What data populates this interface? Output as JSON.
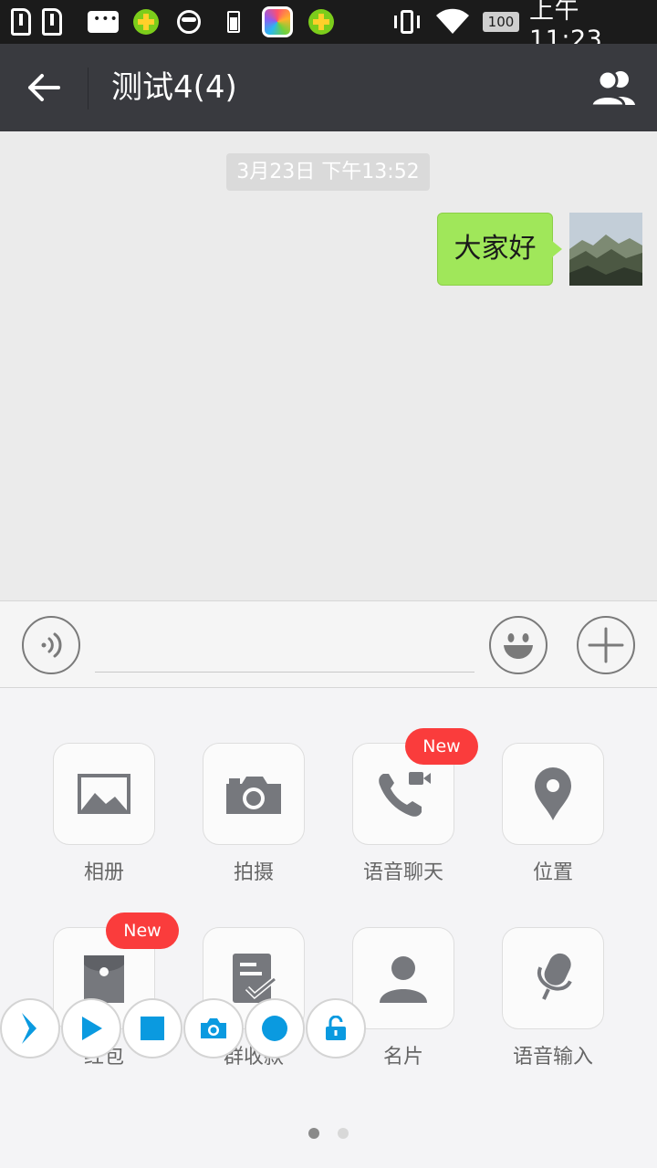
{
  "status_bar": {
    "battery_label": "100",
    "time": "上午11:23",
    "icons": [
      "sim1-icon",
      "sim2-icon",
      "message-icon",
      "360-plus-icon",
      "face-icon",
      "battery-small-icon",
      "colorful-app-icon",
      "360-plus-icon",
      "vibrate-icon",
      "wifi-icon",
      "battery-icon"
    ]
  },
  "titlebar": {
    "title": "测试4(4)",
    "back_icon": "arrow-left-icon",
    "group_icon": "group-members-icon"
  },
  "chat": {
    "timestamp": "3月23日 下午13:52",
    "messages": [
      {
        "text": "大家好",
        "sender": "self",
        "bubble_color": "#a0e75a"
      }
    ]
  },
  "input_bar": {
    "value": "",
    "placeholder": "",
    "voice_icon": "voice-icon",
    "emoji_icon": "emoji-icon",
    "more_icon": "plus-icon"
  },
  "panel": {
    "row1": [
      {
        "label": "相册",
        "icon": "album-icon",
        "badge": ""
      },
      {
        "label": "拍摄",
        "icon": "camera-icon",
        "badge": ""
      },
      {
        "label": "语音聊天",
        "icon": "voice-call-icon",
        "badge": "New"
      },
      {
        "label": "位置",
        "icon": "location-icon",
        "badge": ""
      }
    ],
    "row2": [
      {
        "label": "红包",
        "icon": "red-packet-icon",
        "badge": "New"
      },
      {
        "label": "群收款",
        "icon": "group-payment-icon",
        "badge": ""
      },
      {
        "label": "名片",
        "icon": "contact-card-icon",
        "badge": ""
      },
      {
        "label": "语音输入",
        "icon": "voice-input-icon",
        "badge": ""
      }
    ],
    "page_indicator": {
      "pages": 2,
      "current": 1
    }
  },
  "floating_toolbar": [
    "chevron-right-icon",
    "play-icon",
    "stop-icon",
    "camera-icon",
    "record-icon",
    "unlock-icon"
  ],
  "colors": {
    "titlebar": "#393a3f",
    "accent_green": "#a0e75a",
    "badge_red": "#fa3c3c",
    "float_blue": "#0a9ae0"
  }
}
